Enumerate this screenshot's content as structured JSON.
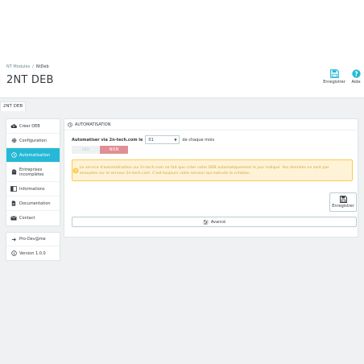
{
  "breadcrumb": {
    "parent": "NT Modules",
    "separator": "/",
    "current": "NtDeb"
  },
  "page_title": "2NT DEB",
  "toolbar": {
    "save_label": "Enregistrer",
    "help_label": "Aide"
  },
  "tab": {
    "label": "2NT DEB"
  },
  "sidebar": {
    "items": [
      {
        "label": "Créer DEB",
        "icon": "cloud-upload-icon",
        "active": false
      },
      {
        "label": "Configuration",
        "icon": "gear-icon",
        "active": false
      },
      {
        "label": "Automatisation",
        "icon": "clock-icon",
        "active": true
      },
      {
        "label": "Entreprises incomplètes",
        "icon": "building-icon",
        "active": false
      },
      {
        "label": "Informations",
        "icon": "info-book-icon",
        "active": false
      },
      {
        "label": "Documentation",
        "icon": "file-icon",
        "active": false
      },
      {
        "label": "Contact",
        "icon": "envelope-icon",
        "active": false
      }
    ],
    "extra": [
      {
        "label": "Pro-Dev@me",
        "icon": "arrow-right-icon"
      },
      {
        "label": "Version 1.0.0",
        "icon": "info-circle-icon"
      }
    ]
  },
  "panel": {
    "title": "Automatisation",
    "form": {
      "label": "Automatiser via 2n-tech.com le",
      "day_value": "01",
      "suffix": "de chaque mois"
    },
    "switch": {
      "yes": "OUI",
      "no": "NON",
      "selected": "NON"
    },
    "alert": "Le service d'automatisation via 2n-tech.com ne fait que créer votre DEB automatiquement le jour indiqué. Vos données ne sont pas envoyées sur le serveur 2n-tech.com. C'est toujours votre serveur qui exécute la création.",
    "save_button": "Enregistrer",
    "advanced_button": "Avancé"
  },
  "colors": {
    "accent": "#25b9d7",
    "danger": "#e08f95",
    "warning_bg": "#fff3d7",
    "warning_border": "#fcc94f"
  }
}
